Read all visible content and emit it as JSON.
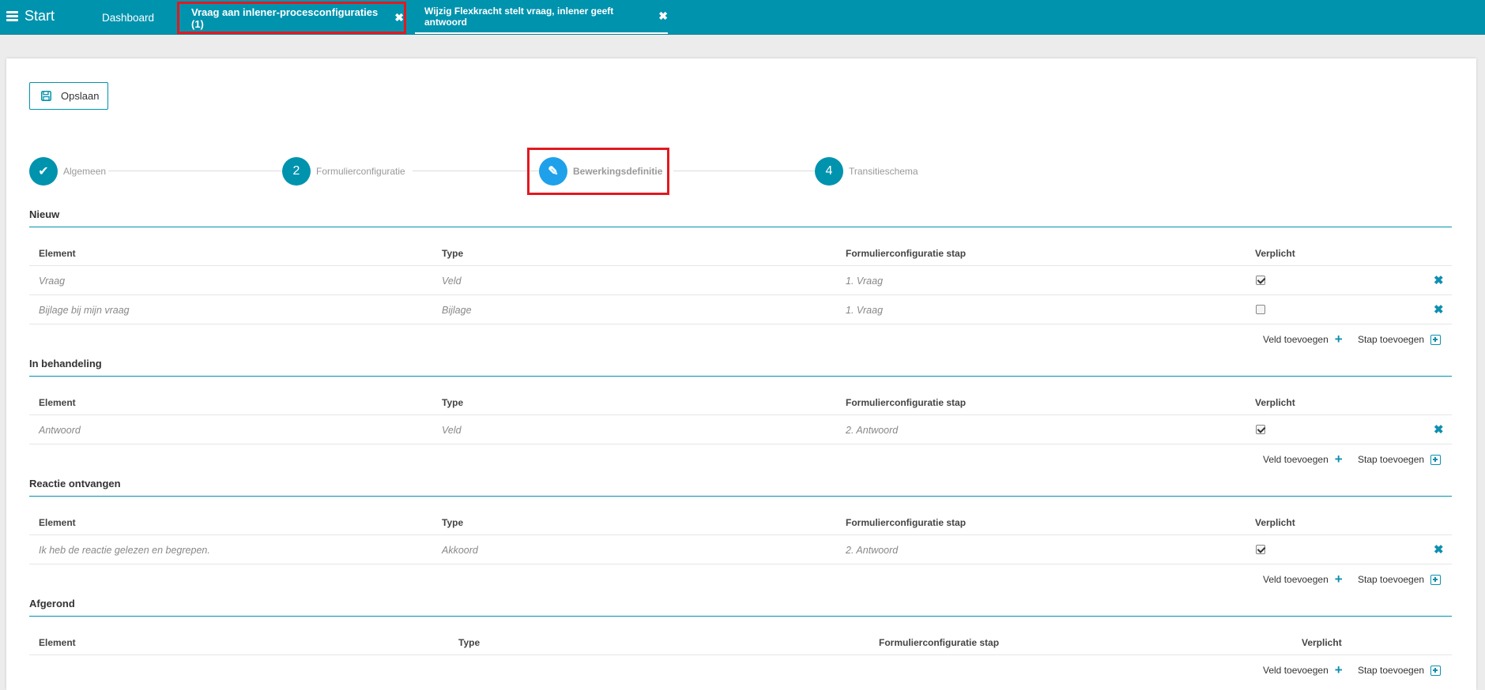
{
  "topbar": {
    "start_label": "Start",
    "tabs": [
      {
        "label": "Dashboard"
      },
      {
        "label": "Vraag aan inlener-procesconfiguraties (1)",
        "close": "✖"
      },
      {
        "label": "Wijzig Flexkracht stelt vraag, inlener geeft antwoord",
        "close": "✖"
      }
    ]
  },
  "toolbar": {
    "save_label": "Opslaan"
  },
  "stepper": {
    "steps": [
      {
        "marker": "✔",
        "label": "Algemeen",
        "state": "done"
      },
      {
        "marker": "2",
        "label": "Formulierconfiguratie",
        "state": "todo"
      },
      {
        "marker": "✎",
        "label": "Bewerkingsdefinitie",
        "state": "active"
      },
      {
        "marker": "4",
        "label": "Transitieschema",
        "state": "todo"
      }
    ]
  },
  "columns": {
    "element": "Element",
    "type": "Type",
    "step": "Formulierconfiguratie stap",
    "required": "Verplicht"
  },
  "actions": {
    "add_field": "Veld toevoegen",
    "add_step": "Stap toevoegen"
  },
  "sections": [
    {
      "title": "Nieuw",
      "rows": [
        {
          "element": "Vraag",
          "type": "Veld",
          "step": "1. Vraag",
          "required": true
        },
        {
          "element": "Bijlage bij mijn vraag",
          "type": "Bijlage",
          "step": "1. Vraag",
          "required": false
        }
      ]
    },
    {
      "title": "In behandeling",
      "rows": [
        {
          "element": "Antwoord",
          "type": "Veld",
          "step": "2. Antwoord",
          "required": true
        }
      ]
    },
    {
      "title": "Reactie ontvangen",
      "rows": [
        {
          "element": "Ik heb de reactie gelezen en begrepen.",
          "type": "Akkoord",
          "step": "2. Antwoord",
          "required": true
        }
      ]
    },
    {
      "title": "Afgerond",
      "rows": []
    }
  ],
  "colors": {
    "brand": "#0093ae",
    "active_step": "#1ea1ea",
    "highlight": "#e2191f"
  }
}
